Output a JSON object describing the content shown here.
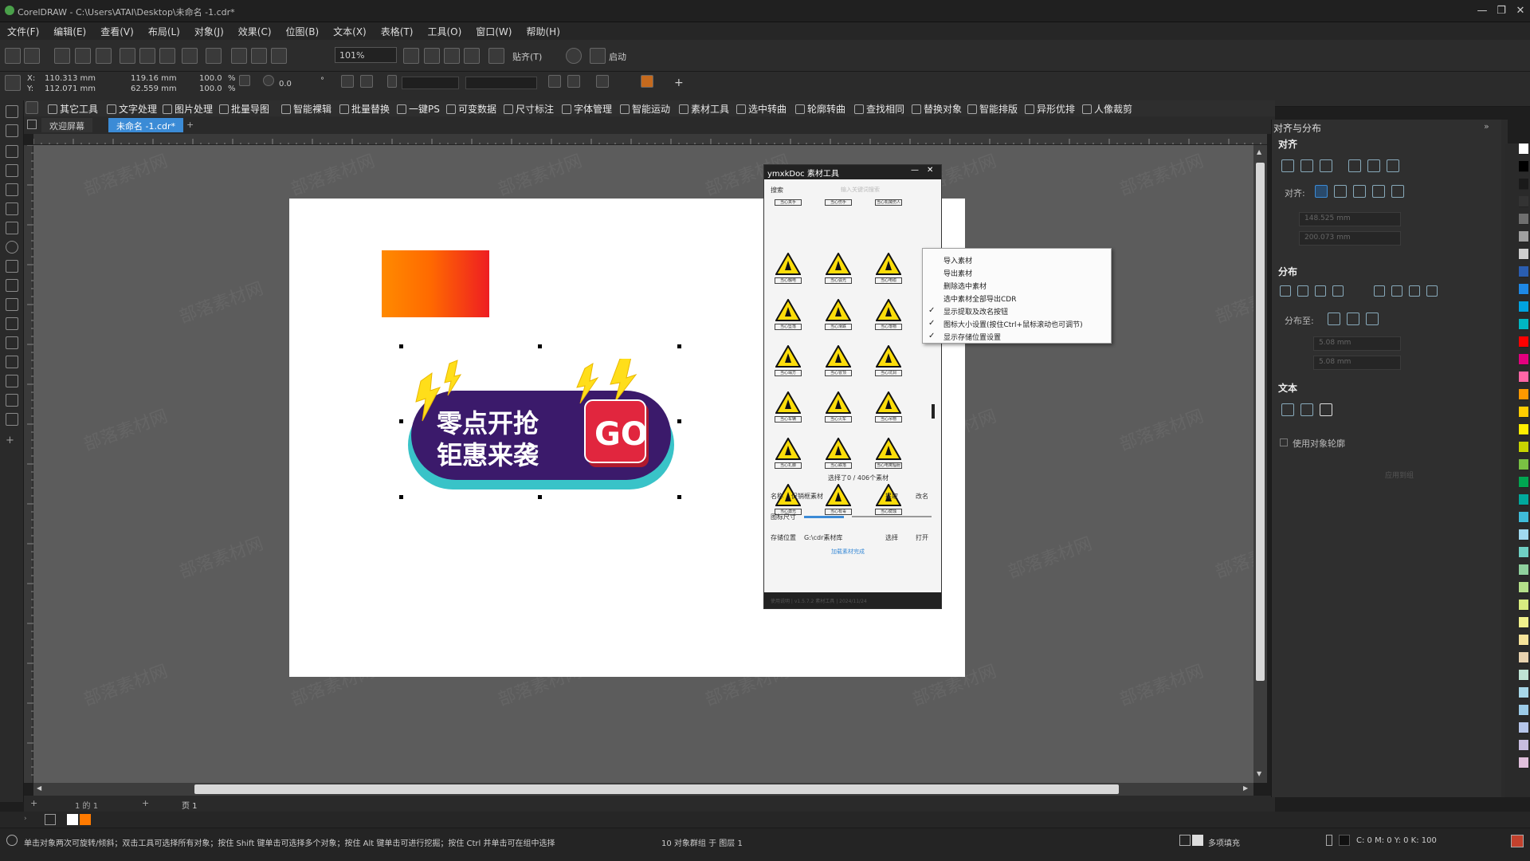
{
  "window": {
    "title": "CorelDRAW - C:\\Users\\ATAI\\Desktop\\未命名 -1.cdr*",
    "controls": [
      "—",
      "❐",
      "✕"
    ]
  },
  "menu": [
    "文件(F)",
    "编辑(E)",
    "查看(V)",
    "布局(L)",
    "对象(J)",
    "效果(C)",
    "位图(B)",
    "文本(X)",
    "表格(T)",
    "工具(O)",
    "窗口(W)",
    "帮助(H)"
  ],
  "toolbar": {
    "zoom": "101%",
    "snap_label": "贴齐(T)",
    "launch_label": "启动"
  },
  "properties": {
    "x": "110.313 mm",
    "y": "112.071 mm",
    "w": "119.16 mm",
    "h": "62.559 mm",
    "scale_x": "100.0",
    "scale_y": "100.0",
    "percent": "%",
    "rotation": "0.0",
    "degree": "°"
  },
  "plugins": [
    "其它工具",
    "文字处理",
    "图片处理",
    "批量导图",
    "智能裸辑",
    "批量替换",
    "一键PS",
    "可变数据",
    "尺寸标注",
    "字体管理",
    "智能运动",
    "素材工具",
    "选中转曲",
    "轮廓转曲",
    "查找相同",
    "替换对象",
    "智能排版",
    "异形优排",
    "人像裁剪"
  ],
  "tabs": {
    "welcome": "欢迎屏幕",
    "doc": "未命名 -1.cdr*",
    "add": "+"
  },
  "banner": {
    "line1": "零点开抢",
    "line2": "钜惠来袭",
    "badge": "GO"
  },
  "plugin_panel": {
    "title": "ymxkDoc 素材工具",
    "search_tab": "搜索",
    "search_placeholder": "输入关键词搜索",
    "status": "选择了0 / 406个素材",
    "name_label": "名称",
    "name_value": "促销框素材",
    "extract_button": "提取",
    "modify_button": "改名",
    "size_label": "图标尺寸",
    "location_label": "存储位置",
    "location_value": "G:\\cdr素材库",
    "choose_button": "选择",
    "open_button": "打开",
    "link_text": "加载素材完成",
    "footer": "使用说明 | v1.5.7.2 素材工具 | 2024/11/24",
    "captions": [
      "当心夹手",
      "当心伤手",
      "当心机械伤人",
      "当心触电",
      "当心弧光",
      "当心电缆",
      "当心坠落",
      "当心滑跌",
      "当心落物",
      "当心塌方",
      "当心冒顶",
      "当心坑洞",
      "当心车辆",
      "当心火车",
      "当心吊物",
      "当心扎脚",
      "当心跌落",
      "当心电离辐射",
      "当心激光",
      "当心有毒",
      "当心腐蚀"
    ],
    "context_menu": [
      {
        "label": "导入素材",
        "checked": false
      },
      {
        "label": "导出素材",
        "checked": false
      },
      {
        "label": "删除选中素材",
        "checked": false
      },
      {
        "label": "选中素材全部导出CDR",
        "checked": false
      },
      {
        "label": "显示提取及改名按钮",
        "checked": true
      },
      {
        "label": "图标大小设置(按住Ctrl+鼠标滚动也可调节)",
        "checked": true
      },
      {
        "label": "显示存储位置设置",
        "checked": true
      }
    ]
  },
  "docker": {
    "title": "对齐与分布",
    "align": "对齐",
    "align_to": "对齐:",
    "align_x": "148.525 mm",
    "align_y": "200.073 mm",
    "distribute": "分布",
    "distribute_to": "分布至:",
    "dist_x": "5.08 mm",
    "dist_y": "5.08 mm",
    "text": "文本",
    "use_outline": "使用对象轮廓",
    "apply": "应用到组"
  },
  "page_nav": {
    "page_of": "1 的 1",
    "page_tab": "页 1",
    "add": "+"
  },
  "status": {
    "hint": "单击对象两次可旋转/倾斜；双击工具可选择所有对象；按住 Shift 键单击可选择多个对象；按住 Alt 键单击可进行挖掘；按住 Ctrl 并单击可在组中选择",
    "selection": "10 对象群组 于 图层 1",
    "fill": "多项填充",
    "color_readout": "C: 0 M: 0 Y: 0 K: 100"
  },
  "watermark": "部落素材网",
  "colors": {
    "accent_blue": "#3b8bd6",
    "banner_purple": "#3b1a6b",
    "banner_teal": "#39c3c8",
    "badge_red": "#e1263e",
    "bolt_yellow": "#ffde1a",
    "warning_yellow": "#fcdd0a"
  }
}
